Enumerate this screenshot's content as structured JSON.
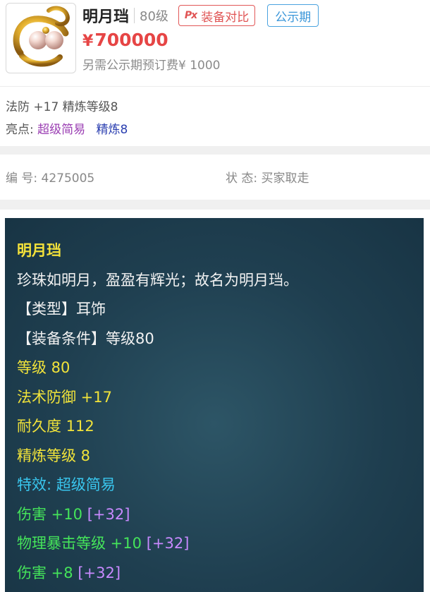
{
  "item": {
    "name": "明月珰",
    "level": "80级",
    "compare_button": "装备对比",
    "compare_icon": "Px",
    "status_badge": "公示期",
    "price_symbol": "¥",
    "price": "700000",
    "deposit_note": "另需公示期预订费¥ 1000"
  },
  "attributes": {
    "line1": "法防 +17 精炼等级8",
    "highlights_label": "亮点:",
    "highlight_1": "超级简易",
    "highlight_2": "精炼8"
  },
  "info": {
    "serial": "编 号: 4275005",
    "state": "状 态: 买家取走"
  },
  "detail": {
    "name": "明月珰",
    "description": "珍珠如明月，盈盈有辉光；故名为明月珰。",
    "type": "【类型】耳饰",
    "requirement": "【装备条件】等级80",
    "level": "等级 80",
    "magic_defense": "法术防御 +17",
    "durability": "耐久度 112",
    "refine": "精炼等级 8",
    "special": "特效: 超级简易",
    "bonus_1": "伤害 +10",
    "bonus_1_extra": "[+32]",
    "bonus_2": "物理暴击等级 +10",
    "bonus_2_extra": "[+32]",
    "bonus_3": "伤害 +8",
    "bonus_3_extra": "[+32]"
  },
  "colors": {
    "price": "#e64545",
    "compare_border": "#e25757",
    "badge_border": "#4aa3df",
    "panel_bg": "#1f3f50",
    "gold_text": "#f4e23a",
    "cyan_text": "#39c6ee",
    "green_text": "#45e45a",
    "purple_bracket": "#c889ff"
  },
  "icons": {
    "thumbnail": "pearl-earring-icon",
    "compare": "px-compare-icon"
  }
}
